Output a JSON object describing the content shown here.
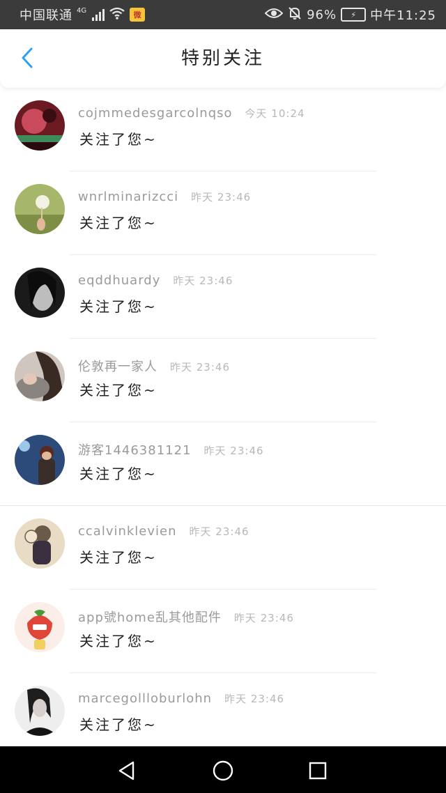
{
  "status_bar": {
    "carrier": "中国联通",
    "network": "4G",
    "battery": "96%",
    "time": "中午11:25",
    "icons": [
      "signal-icon",
      "wifi-icon",
      "weibo-icon",
      "eye-icon",
      "mute-icon",
      "battery-icon"
    ]
  },
  "header": {
    "title": "特别关注",
    "back_icon": "back-chevron-icon",
    "accent": "#2ea0f0"
  },
  "items": [
    {
      "name": "cojmmedesgarcolnqso",
      "time": "今天 10:24",
      "message": "关注了您~"
    },
    {
      "name": "wnrlminarizcci",
      "time": "昨天 23:46",
      "message": "关注了您~"
    },
    {
      "name": "eqddhuardy",
      "time": "昨天 23:46",
      "message": "关注了您~"
    },
    {
      "name": "伦敦再一家人",
      "time": "昨天 23:46",
      "message": "关注了您~"
    },
    {
      "name": "游客1446381121",
      "time": "昨天 23:46",
      "message": "关注了您~"
    },
    {
      "name": "ccalvinklevien",
      "time": "昨天 23:46",
      "message": "关注了您~"
    },
    {
      "name": "app號home乱其他配件",
      "time": "昨天 23:46",
      "message": "关注了您~"
    },
    {
      "name": "marcegollloburlohn",
      "time": "昨天 23:46",
      "message": "关注了您~"
    }
  ],
  "nav_bar": {
    "icons": [
      "back-triangle-icon",
      "home-circle-icon",
      "recents-square-icon"
    ]
  }
}
